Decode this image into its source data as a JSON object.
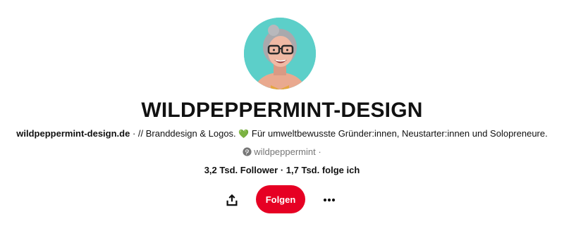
{
  "profile": {
    "display_name": "WILDPEPPERMINT-DESIGN",
    "website": "wildpeppermint-design.de",
    "bio_separator": " · ",
    "bio_prefix": "// Branddesign & Logos.",
    "bio_heart": "💚",
    "bio_suffix": "Für umweltbewusste Gründer:innen, Neustarter:innen und Solopreneure.",
    "handle": "wildpeppermint",
    "handle_suffix": " ·",
    "followers": "3,2 Tsd. Follower",
    "stats_separator": " · ",
    "following": "1,7 Tsd. folge ich"
  },
  "actions": {
    "follow_label": "Folgen"
  },
  "icons": {
    "share": "share-icon",
    "more": "more-dots-icon",
    "pinterest": "pinterest-logo-icon"
  },
  "colors": {
    "accent": "#e60023",
    "avatar_bg": "#5ccfc9",
    "muted_text": "#767676",
    "heart": "#2faa78"
  }
}
